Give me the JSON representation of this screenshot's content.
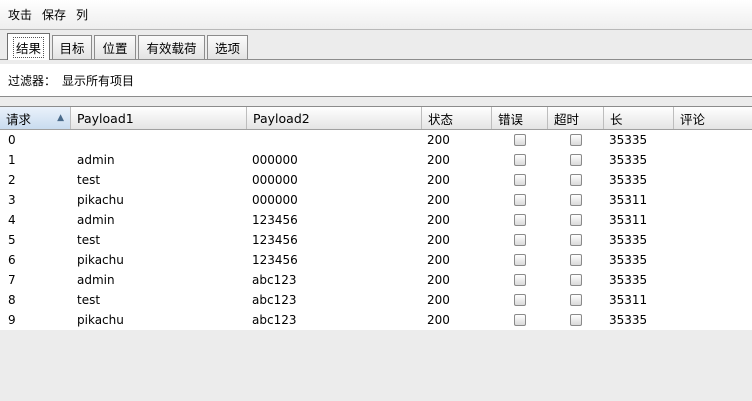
{
  "menu": [
    "攻击",
    "保存",
    "列"
  ],
  "tabs": [
    {
      "label": "结果",
      "active": true
    },
    {
      "label": "目标",
      "active": false
    },
    {
      "label": "位置",
      "active": false
    },
    {
      "label": "有效载荷",
      "active": false
    },
    {
      "label": "选项",
      "active": false
    }
  ],
  "filter": {
    "label": "过滤器：",
    "value": "显示所有项目"
  },
  "columns": [
    "请求",
    "Payload1",
    "Payload2",
    "状态",
    "错误",
    "超时",
    "长",
    "评论"
  ],
  "sort_indicator": "▲",
  "rows": [
    {
      "request": "0",
      "payload1": "",
      "payload2": "",
      "status": "200",
      "error": false,
      "timeout": false,
      "length": "35335",
      "comment": ""
    },
    {
      "request": "1",
      "payload1": "admin",
      "payload2": "000000",
      "status": "200",
      "error": false,
      "timeout": false,
      "length": "35335",
      "comment": ""
    },
    {
      "request": "2",
      "payload1": "test",
      "payload2": "000000",
      "status": "200",
      "error": false,
      "timeout": false,
      "length": "35335",
      "comment": ""
    },
    {
      "request": "3",
      "payload1": "pikachu",
      "payload2": "000000",
      "status": "200",
      "error": false,
      "timeout": false,
      "length": "35311",
      "comment": ""
    },
    {
      "request": "4",
      "payload1": "admin",
      "payload2": "123456",
      "status": "200",
      "error": false,
      "timeout": false,
      "length": "35311",
      "comment": ""
    },
    {
      "request": "5",
      "payload1": "test",
      "payload2": "123456",
      "status": "200",
      "error": false,
      "timeout": false,
      "length": "35335",
      "comment": ""
    },
    {
      "request": "6",
      "payload1": "pikachu",
      "payload2": "123456",
      "status": "200",
      "error": false,
      "timeout": false,
      "length": "35335",
      "comment": ""
    },
    {
      "request": "7",
      "payload1": "admin",
      "payload2": "abc123",
      "status": "200",
      "error": false,
      "timeout": false,
      "length": "35335",
      "comment": ""
    },
    {
      "request": "8",
      "payload1": "test",
      "payload2": "abc123",
      "status": "200",
      "error": false,
      "timeout": false,
      "length": "35311",
      "comment": ""
    },
    {
      "request": "9",
      "payload1": "pikachu",
      "payload2": "abc123",
      "status": "200",
      "error": false,
      "timeout": false,
      "length": "35335",
      "comment": ""
    }
  ]
}
